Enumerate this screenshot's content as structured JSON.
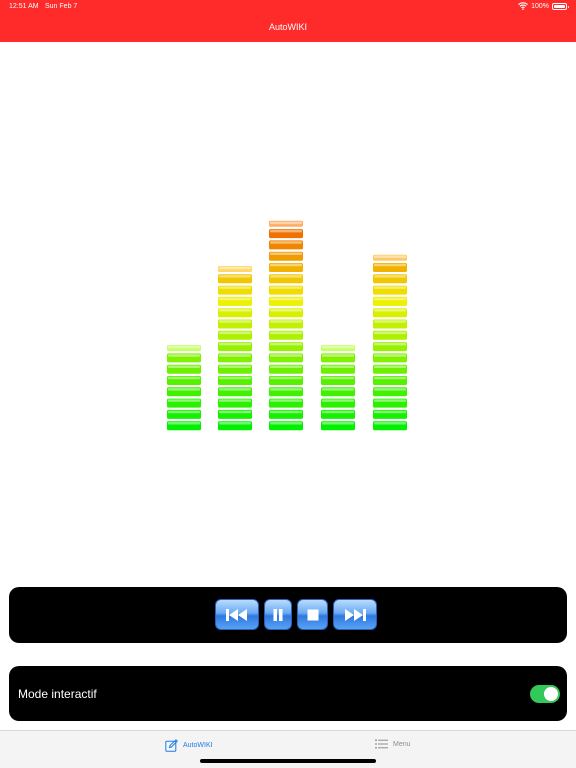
{
  "status_bar": {
    "time": "12:51 AM",
    "date": "Sun Feb 7",
    "battery": "100%",
    "battery_level": 1.0
  },
  "nav": {
    "title": "AutoWIKI"
  },
  "equalizer": {
    "levels": [
      8,
      15,
      19,
      8,
      16
    ]
  },
  "player": {
    "buttons": [
      "previous",
      "pause",
      "stop",
      "next"
    ]
  },
  "mode": {
    "label": "Mode interactif",
    "enabled": true
  },
  "tabbar": {
    "tabs": [
      {
        "label": "AutoWIKI",
        "active": true
      },
      {
        "label": "Menu",
        "active": false
      }
    ]
  },
  "colors": {
    "header": "#ff2a2a",
    "tab_active": "#1e7ce6",
    "toggle_on": "#34c759"
  }
}
